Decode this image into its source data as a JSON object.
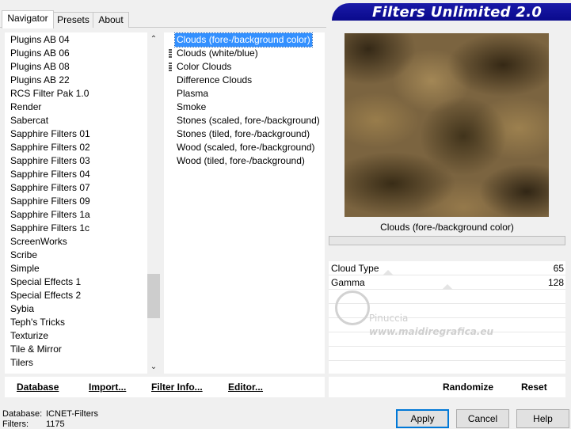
{
  "tabs": [
    {
      "label": "Navigator",
      "active": true
    },
    {
      "label": "Presets",
      "active": false
    },
    {
      "label": "About",
      "active": false
    }
  ],
  "title": "Filters Unlimited 2.0",
  "categories": [
    "Plugins AB 04",
    "Plugins AB 06",
    "Plugins AB 08",
    "Plugins AB 22",
    "RCS Filter Pak 1.0",
    "Render",
    "Sabercat",
    "Sapphire Filters 01",
    "Sapphire Filters 02",
    "Sapphire Filters 03",
    "Sapphire Filters 04",
    "Sapphire Filters 07",
    "Sapphire Filters 09",
    "Sapphire Filters 1a",
    "Sapphire Filters 1c",
    "ScreenWorks",
    "Scribe",
    "Simple",
    "Special Effects 1",
    "Special Effects 2",
    "Sybia",
    "Teph's Tricks",
    "Texturize",
    "Tile & Mirror",
    "Tilers"
  ],
  "filters": [
    {
      "label": "Clouds (fore-/background color)",
      "selected": true,
      "marked": false
    },
    {
      "label": "Clouds (white/blue)",
      "selected": false,
      "marked": true
    },
    {
      "label": "Color Clouds",
      "selected": false,
      "marked": true
    },
    {
      "label": "Difference Clouds",
      "selected": false,
      "marked": false
    },
    {
      "label": "Plasma",
      "selected": false,
      "marked": false
    },
    {
      "label": "Smoke",
      "selected": false,
      "marked": false
    },
    {
      "label": "Stones (scaled, fore-/background)",
      "selected": false,
      "marked": false
    },
    {
      "label": "Stones (tiled, fore-/background)",
      "selected": false,
      "marked": false
    },
    {
      "label": "Wood (scaled, fore-/background)",
      "selected": false,
      "marked": false
    },
    {
      "label": "Wood (tiled, fore-/background)",
      "selected": false,
      "marked": false
    }
  ],
  "preview": {
    "label": "Clouds (fore-/background color)",
    "colors": {
      "dark": "#2e2414",
      "light": "#b09468"
    }
  },
  "params": [
    {
      "label": "Cloud Type",
      "value": "65"
    },
    {
      "label": "Gamma",
      "value": "128"
    }
  ],
  "watermark": {
    "name": "Pinuccia",
    "url": "www.maidiregrafica.eu"
  },
  "left_buttons": {
    "database": "Database",
    "import": "Import...",
    "filter_info": "Filter Info...",
    "editor": "Editor..."
  },
  "right_buttons": {
    "randomize": "Randomize",
    "reset": "Reset"
  },
  "status": {
    "database_label": "Database:",
    "database_value": "ICNET-Filters",
    "filters_label": "Filters:",
    "filters_value": "1175"
  },
  "dialog_buttons": {
    "apply": "Apply",
    "cancel": "Cancel",
    "help": "Help"
  },
  "colors": {
    "accent": "#0078d7",
    "selection": "#3390ff",
    "banner": "#0a0a8c"
  }
}
